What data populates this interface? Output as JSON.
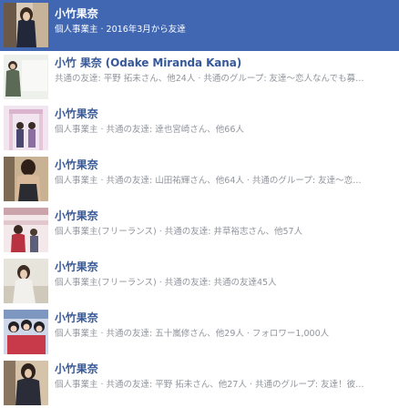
{
  "results": [
    {
      "name": "小竹果奈",
      "desc": "個人事業主 · 2016年3月から友達"
    },
    {
      "name": "小竹 果奈 (Odake Miranda Kana)",
      "desc": "共通の友達: 平野 拓未さん、他24人 · 共通のグループ: 友達〜恋人なんでも募…"
    },
    {
      "name": "小竹果奈",
      "desc": "個人事業主 · 共通の友達: 達也宮崎さん、他66人"
    },
    {
      "name": "小竹果奈",
      "desc": "個人事業主 · 共通の友達: 山田祐輝さん、他64人 · 共通のグループ: 友達〜恋…"
    },
    {
      "name": "小竹果奈",
      "desc": "個人事業主(フリーランス) · 共通の友達: 井草裕志さん、他57人"
    },
    {
      "name": "小竹果奈",
      "desc": "個人事業主(フリーランス) · 共通の友達: 共通の友達45人"
    },
    {
      "name": "小竹果奈",
      "desc": "個人事業主 · 共通の友達: 五十嵐修さん、他29人 · フォロワー1,000人"
    },
    {
      "name": "小竹果奈",
      "desc": "個人事業主 · 共通の友達: 平野 拓未さん、他27人 · 共通のグループ: 友達！彼…"
    }
  ],
  "colors": {
    "selected_bg": "#4267b2",
    "name": "#365899",
    "meta": "#90949c"
  }
}
